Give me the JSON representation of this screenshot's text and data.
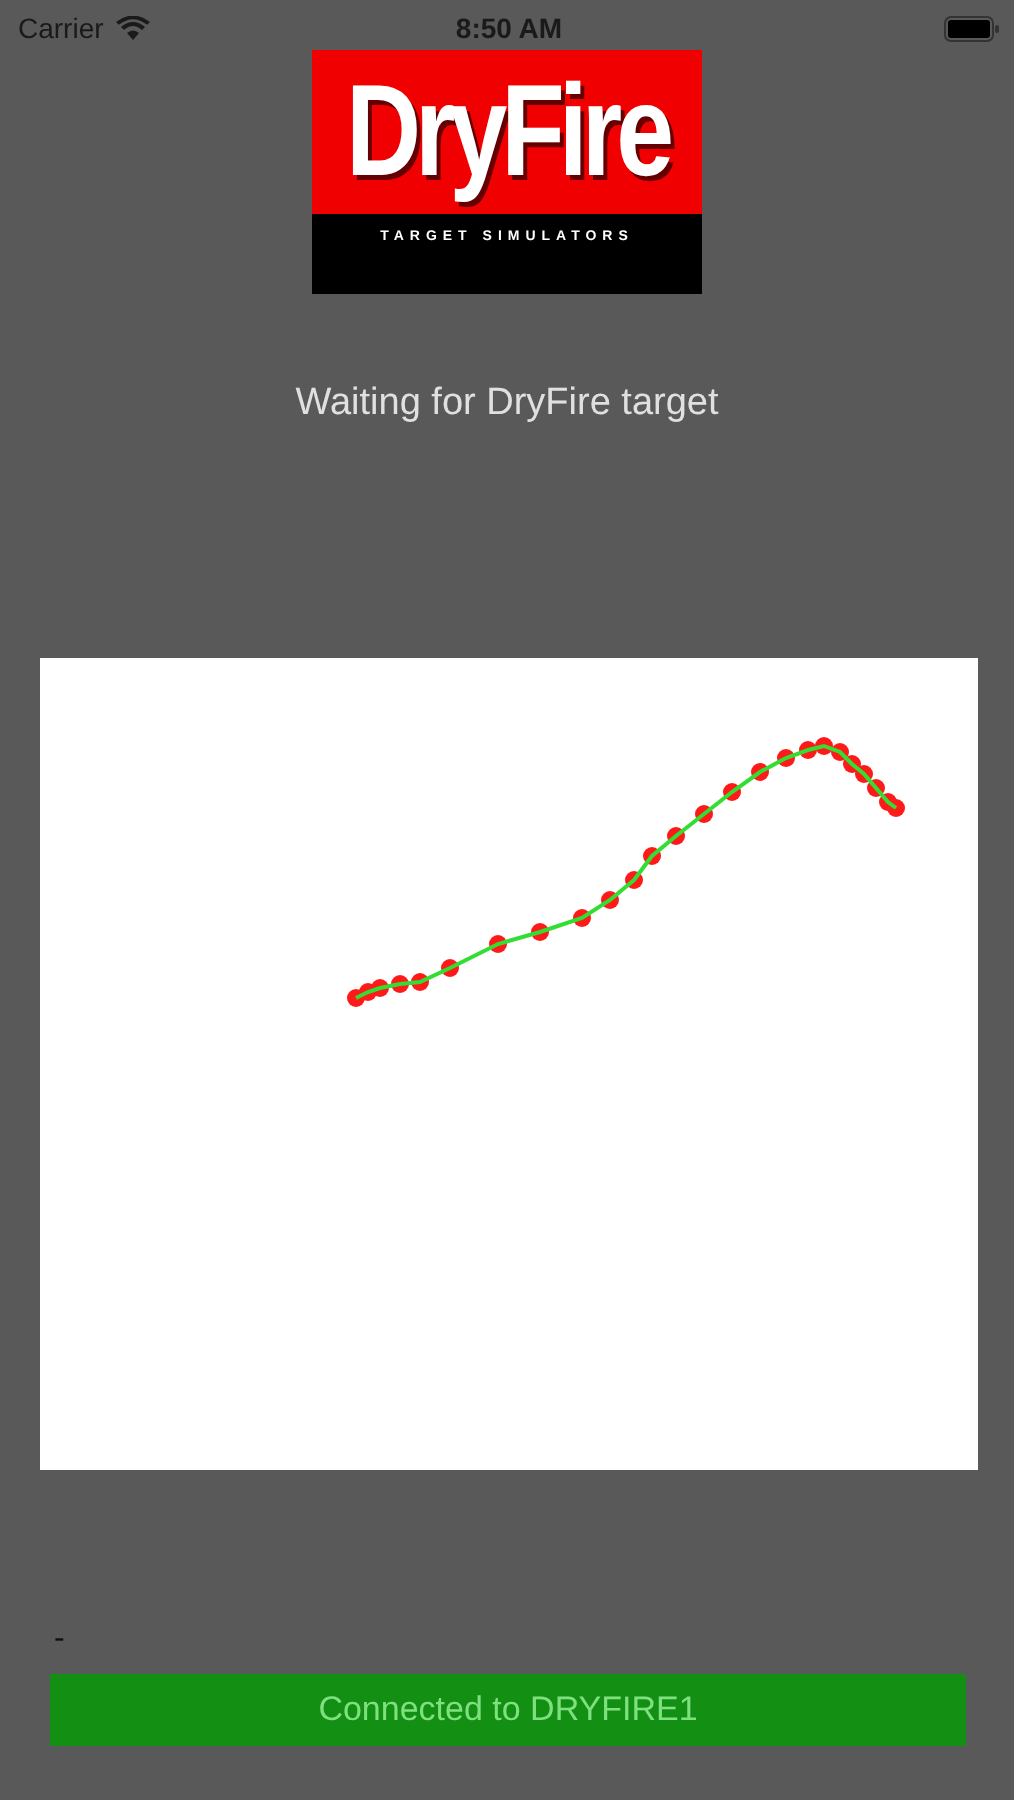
{
  "status_bar": {
    "carrier": "Carrier",
    "time": "8:50 AM"
  },
  "logo": {
    "brand": "DryFire",
    "tagline": "TARGET SIMULATORS"
  },
  "message": "Waiting for DryFire target",
  "target": {
    "kind": "trace"
  },
  "shot_label": "-",
  "connection_button": {
    "label": "Connected to DRYFIRE1",
    "connected": true
  }
}
